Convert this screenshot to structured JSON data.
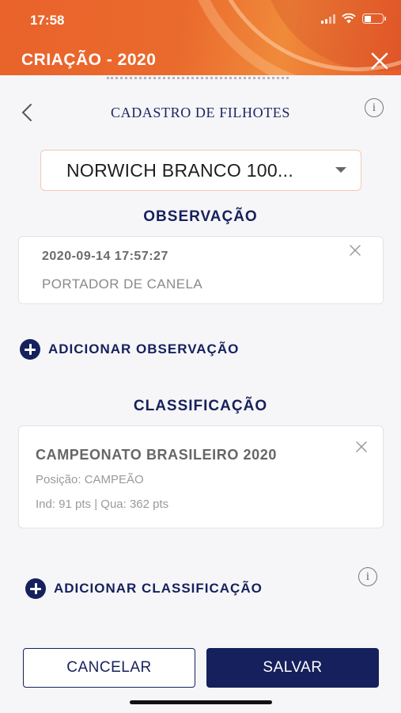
{
  "status_bar": {
    "time": "17:58"
  },
  "header": {
    "title": "CRIAÇÃO - 2020",
    "close_icon": "close-icon"
  },
  "nav": {
    "title": "CADASTRO DE FILHOTES",
    "back_icon": "chevron-left-icon",
    "info_icon": "info-icon",
    "info_glyph": "i"
  },
  "select": {
    "value": "NORWICH BRANCO 100..."
  },
  "observacao": {
    "section_title": "OBSERVAÇÃO",
    "items": [
      {
        "date": "2020-09-14 17:57:27",
        "text": "PORTADOR DE CANELA"
      }
    ],
    "add_label": "ADICIONAR OBSERVAÇÃO"
  },
  "classificacao": {
    "section_title": "CLASSIFICAÇÃO",
    "items": [
      {
        "name": "CAMPEONATO BRASILEIRO 2020",
        "position": "Posição: CAMPEÃO",
        "points": "Ind: 91 pts | Qua: 362 pts"
      }
    ],
    "add_label": "ADICIONAR CLASSIFICAÇÃO"
  },
  "actions": {
    "cancel_label": "CANCELAR",
    "save_label": "SALVAR"
  },
  "colors": {
    "header_orange": "#e9632b",
    "navy": "#16205c"
  }
}
